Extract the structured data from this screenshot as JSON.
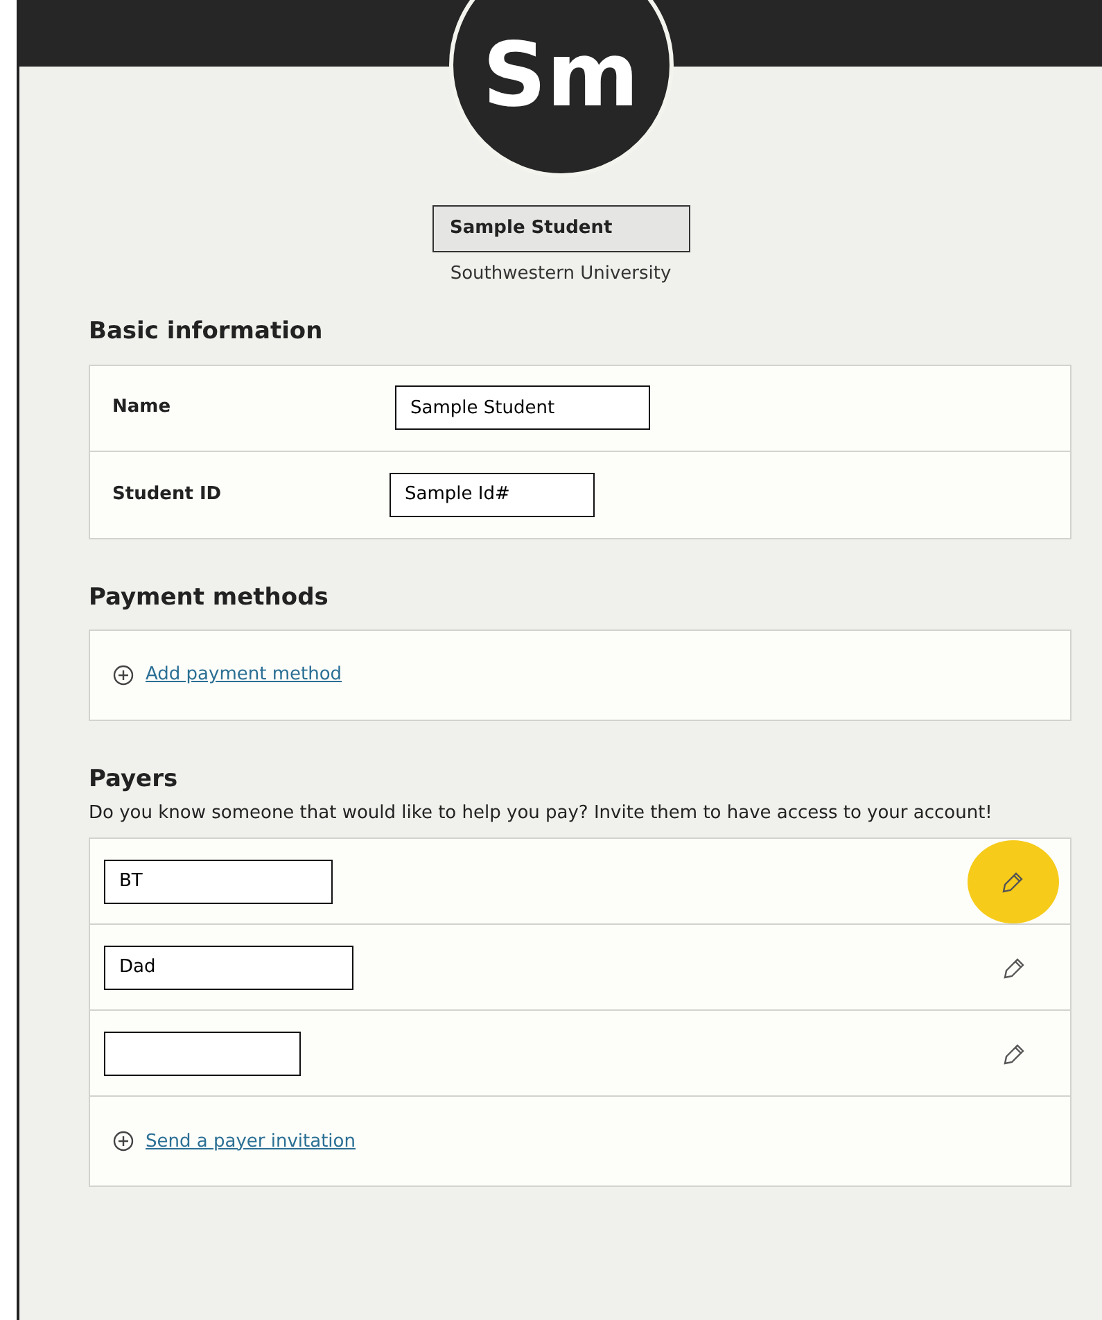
{
  "profile": {
    "initials": "Sm",
    "name": "Sample Student",
    "school": "Southwestern University"
  },
  "basic_information": {
    "title": "Basic information",
    "rows": [
      {
        "label": "Name",
        "value": "Sample Student"
      },
      {
        "label": "Student ID",
        "value": "Sample Id#"
      }
    ]
  },
  "payment_methods": {
    "title": "Payment methods",
    "add_link": "Add payment method"
  },
  "payers": {
    "title": "Payers",
    "description": "Do you know someone that would like to help you pay? Invite them to have access to your account!",
    "items": [
      {
        "value": "BT",
        "highlighted": true
      },
      {
        "value": "Dad",
        "highlighted": false
      },
      {
        "value": "",
        "highlighted": false
      }
    ],
    "invite_link": "Send a payer invitation"
  }
}
